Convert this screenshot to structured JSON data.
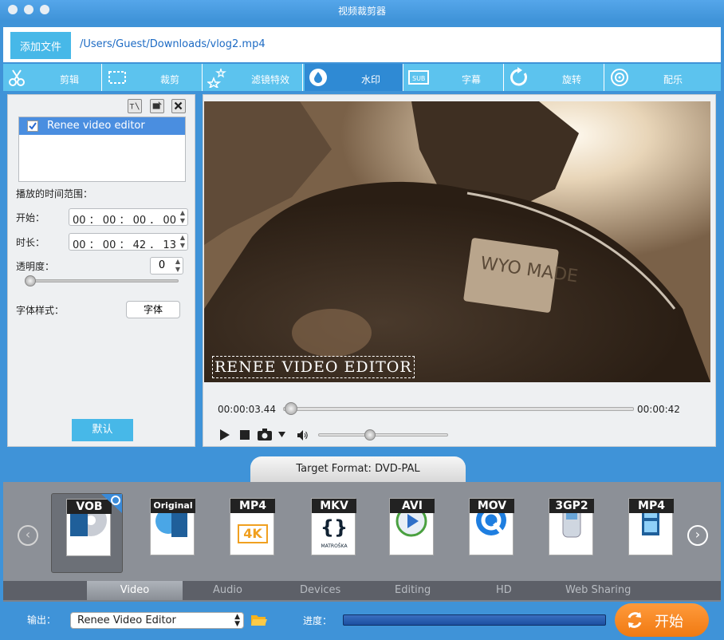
{
  "window": {
    "title": "视频裁剪器"
  },
  "topbar": {
    "add_file": "添加文件",
    "file_path": "/Users/Guest/Downloads/vlog2.mp4"
  },
  "tabs": [
    {
      "label": "剪辑",
      "icon": "scissors-icon"
    },
    {
      "label": "裁剪",
      "icon": "crop-icon"
    },
    {
      "label": "滤镜特效",
      "icon": "stars-icon"
    },
    {
      "label": "水印",
      "icon": "water-drop-icon",
      "active": true
    },
    {
      "label": "字幕",
      "icon": "subtitle-film-icon"
    },
    {
      "label": "旋转",
      "icon": "rotate-icon"
    },
    {
      "label": "配乐",
      "icon": "music-icon"
    }
  ],
  "watermark_panel": {
    "list_item": "Renee video editor",
    "time_range_label": "播放的时间范围：",
    "start_label": "开始：",
    "start_value": "00 ： 00 ： 00 ． 00",
    "duration_label": "时长：",
    "duration_value": "00 ： 00 ： 42 ． 13",
    "opacity_label": "透明度：",
    "opacity_value": "0",
    "opacity_level": 0,
    "font_style_label": "字体样式：",
    "font_button": "字体",
    "default_button": "默认"
  },
  "player": {
    "watermark_text": "RENEE VIDEO EDITOR",
    "current_time": "00:00:03.44",
    "total_time": "00:00:42",
    "progress_fraction": 0.02,
    "volume_fraction": 0.4,
    "video_caption": "WYO MADE"
  },
  "format": {
    "header": "Target Format: DVD-PAL",
    "items": [
      {
        "name": "VOB",
        "selected": true
      },
      {
        "name": "Original"
      },
      {
        "name": "MP4",
        "sub": "4K"
      },
      {
        "name": "MKV",
        "sub": "MATROŠKA"
      },
      {
        "name": "AVI"
      },
      {
        "name": "MOV"
      },
      {
        "name": "3GP2"
      },
      {
        "name": "MP4"
      }
    ],
    "categories": [
      "Video",
      "Audio",
      "Devices",
      "Editing",
      "HD",
      "Web Sharing"
    ],
    "active_category": "Video"
  },
  "output": {
    "label": "输出：",
    "value": "Renee Video Editor",
    "progress_label": "进度：",
    "start_button": "开始"
  },
  "colors": {
    "accent": "#47b8e8",
    "tab_active": "#2f8ad4",
    "start": "#f07a12",
    "window_bg": "#3f93d8"
  }
}
